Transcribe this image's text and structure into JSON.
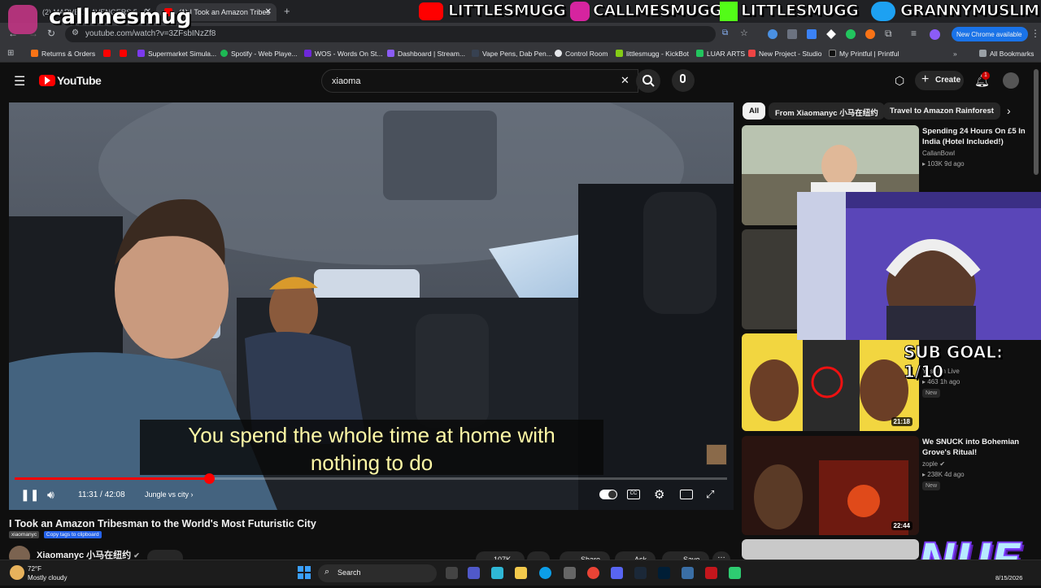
{
  "browser": {
    "tabs": [
      {
        "title": "(2) MARVEL'S AVENGERS 5 - D",
        "active": false
      },
      {
        "title": "(1) I Took an Amazon Tribes",
        "active": true
      }
    ],
    "url": "youtube.com/watch?v=3ZFsbINzZf8",
    "new_chrome_label": "New Chrome available",
    "bookmarks": [
      "Returns & Orders",
      "Supermarket Simula...",
      "Spotify - Web Playe...",
      "WOS - Words On St...",
      "Dashboard | Stream...",
      "Vape Pens, Dab Pen...",
      "Control Room",
      "littlesmugg - KickBot",
      "LUAR ARTS",
      "New Project - Studio",
      "My Printful | Printful"
    ],
    "all_bookmarks": "All Bookmarks"
  },
  "youtube": {
    "logo_text": "YouTube",
    "search_value": "xiaoma",
    "create_label": "Create",
    "notification_count": "1"
  },
  "video": {
    "caption_line1": "You spend the whole time at home with",
    "caption_line2": "nothing to do",
    "time": "11:31 / 42:08",
    "chapter": "Jungle vs city",
    "progress": 0.273,
    "title": "I Took an Amazon Tribesman to the World's Most Futuristic City",
    "tag": "xiaomanyc",
    "copy_tags": "Copy tags to clipboard",
    "channel": "Xiaomanyc 小马在纽约",
    "likes": "107K",
    "share_label": "Share",
    "ask_label": "Ask",
    "save_label": "Save"
  },
  "sidebar": {
    "chips": [
      "All",
      "From Xiaomanyc 小马在纽约",
      "Travel to Amazon Rainforest"
    ],
    "recommendations": [
      {
        "title": "Spending 24 Hours On £5 In India (Hotel Included!)",
        "channel": "CallanBowl",
        "meta": "103K  9d ago",
        "duration": "",
        "badge": ""
      },
      {
        "title": "",
        "channel": "Yusuf7n Live",
        "meta": "463  1h ago",
        "duration": "21:18",
        "badge": "New"
      },
      {
        "title": "We SNUCK into Bohemian Grove's Ritual!",
        "channel": "zople",
        "meta": "238K  4d ago",
        "duration": "22:44",
        "badge": "New"
      }
    ]
  },
  "overlay": {
    "socials": [
      "LITTLESMUGG",
      "CALLMESMUGG",
      "LITTLESMUGG",
      "GRANNYMUSLIM"
    ],
    "callmesmug": "callmesmug",
    "subgoal": "SUB GOAL: 1/10",
    "logo": "NUE"
  },
  "taskbar": {
    "temp": "72°F",
    "weather": "Mostly cloudy",
    "search": "Search",
    "date": "8/15/2026"
  },
  "colors": {
    "youtube_red": "#ff0000",
    "caption_text": "#fff9a6",
    "chrome_blue": "#1a73e8"
  }
}
